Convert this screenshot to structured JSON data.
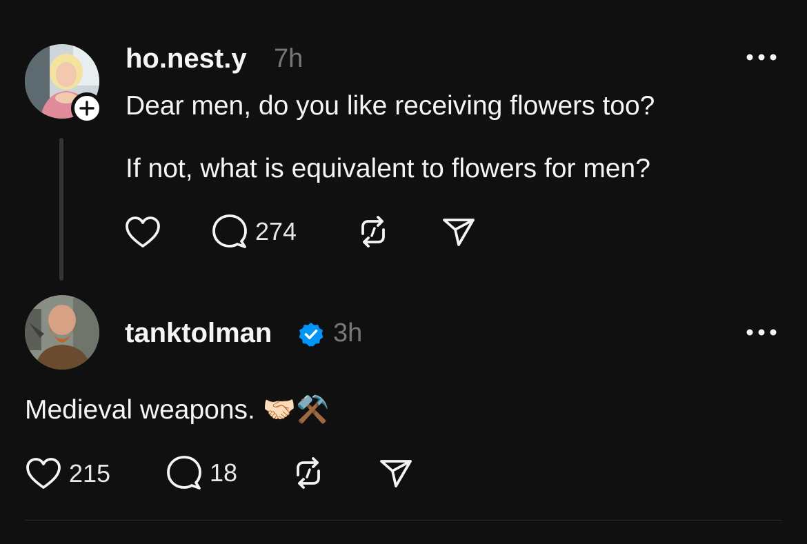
{
  "colors": {
    "background": "#101010",
    "text_primary": "#f3f5f7",
    "text_secondary": "#777777",
    "verified_blue": "#0095f6",
    "thread_line": "#333638"
  },
  "original_post": {
    "username": "ho.nest.y",
    "time": "7h",
    "paragraphs": [
      "Dear men, do you like receiving flowers too?",
      "If not, what is equivalent to flowers for men?"
    ],
    "reply_count": "274",
    "icons": [
      "heart-icon",
      "comment-icon",
      "repost-icon",
      "share-icon",
      "more-icon",
      "follow-plus-icon"
    ]
  },
  "reply_post": {
    "username": "tanktolman",
    "time": "3h",
    "verified": true,
    "text": "Medieval weapons. 🤝🏻⚒️",
    "like_count": "215",
    "reply_count": "18",
    "icons": [
      "heart-icon",
      "comment-icon",
      "repost-icon",
      "share-icon",
      "more-icon",
      "verified-badge-icon"
    ]
  }
}
